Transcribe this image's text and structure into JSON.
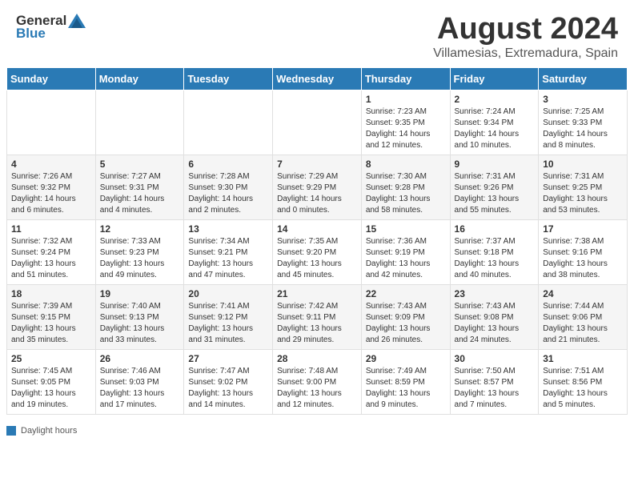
{
  "header": {
    "logo_general": "General",
    "logo_blue": "Blue",
    "title": "August 2024",
    "subtitle": "Villamesias, Extremadura, Spain"
  },
  "calendar": {
    "days_of_week": [
      "Sunday",
      "Monday",
      "Tuesday",
      "Wednesday",
      "Thursday",
      "Friday",
      "Saturday"
    ],
    "weeks": [
      [
        {
          "num": "",
          "info": ""
        },
        {
          "num": "",
          "info": ""
        },
        {
          "num": "",
          "info": ""
        },
        {
          "num": "",
          "info": ""
        },
        {
          "num": "1",
          "info": "Sunrise: 7:23 AM\nSunset: 9:35 PM\nDaylight: 14 hours and 12 minutes."
        },
        {
          "num": "2",
          "info": "Sunrise: 7:24 AM\nSunset: 9:34 PM\nDaylight: 14 hours and 10 minutes."
        },
        {
          "num": "3",
          "info": "Sunrise: 7:25 AM\nSunset: 9:33 PM\nDaylight: 14 hours and 8 minutes."
        }
      ],
      [
        {
          "num": "4",
          "info": "Sunrise: 7:26 AM\nSunset: 9:32 PM\nDaylight: 14 hours and 6 minutes."
        },
        {
          "num": "5",
          "info": "Sunrise: 7:27 AM\nSunset: 9:31 PM\nDaylight: 14 hours and 4 minutes."
        },
        {
          "num": "6",
          "info": "Sunrise: 7:28 AM\nSunset: 9:30 PM\nDaylight: 14 hours and 2 minutes."
        },
        {
          "num": "7",
          "info": "Sunrise: 7:29 AM\nSunset: 9:29 PM\nDaylight: 14 hours and 0 minutes."
        },
        {
          "num": "8",
          "info": "Sunrise: 7:30 AM\nSunset: 9:28 PM\nDaylight: 13 hours and 58 minutes."
        },
        {
          "num": "9",
          "info": "Sunrise: 7:31 AM\nSunset: 9:26 PM\nDaylight: 13 hours and 55 minutes."
        },
        {
          "num": "10",
          "info": "Sunrise: 7:31 AM\nSunset: 9:25 PM\nDaylight: 13 hours and 53 minutes."
        }
      ],
      [
        {
          "num": "11",
          "info": "Sunrise: 7:32 AM\nSunset: 9:24 PM\nDaylight: 13 hours and 51 minutes."
        },
        {
          "num": "12",
          "info": "Sunrise: 7:33 AM\nSunset: 9:23 PM\nDaylight: 13 hours and 49 minutes."
        },
        {
          "num": "13",
          "info": "Sunrise: 7:34 AM\nSunset: 9:21 PM\nDaylight: 13 hours and 47 minutes."
        },
        {
          "num": "14",
          "info": "Sunrise: 7:35 AM\nSunset: 9:20 PM\nDaylight: 13 hours and 45 minutes."
        },
        {
          "num": "15",
          "info": "Sunrise: 7:36 AM\nSunset: 9:19 PM\nDaylight: 13 hours and 42 minutes."
        },
        {
          "num": "16",
          "info": "Sunrise: 7:37 AM\nSunset: 9:18 PM\nDaylight: 13 hours and 40 minutes."
        },
        {
          "num": "17",
          "info": "Sunrise: 7:38 AM\nSunset: 9:16 PM\nDaylight: 13 hours and 38 minutes."
        }
      ],
      [
        {
          "num": "18",
          "info": "Sunrise: 7:39 AM\nSunset: 9:15 PM\nDaylight: 13 hours and 35 minutes."
        },
        {
          "num": "19",
          "info": "Sunrise: 7:40 AM\nSunset: 9:13 PM\nDaylight: 13 hours and 33 minutes."
        },
        {
          "num": "20",
          "info": "Sunrise: 7:41 AM\nSunset: 9:12 PM\nDaylight: 13 hours and 31 minutes."
        },
        {
          "num": "21",
          "info": "Sunrise: 7:42 AM\nSunset: 9:11 PM\nDaylight: 13 hours and 29 minutes."
        },
        {
          "num": "22",
          "info": "Sunrise: 7:43 AM\nSunset: 9:09 PM\nDaylight: 13 hours and 26 minutes."
        },
        {
          "num": "23",
          "info": "Sunrise: 7:43 AM\nSunset: 9:08 PM\nDaylight: 13 hours and 24 minutes."
        },
        {
          "num": "24",
          "info": "Sunrise: 7:44 AM\nSunset: 9:06 PM\nDaylight: 13 hours and 21 minutes."
        }
      ],
      [
        {
          "num": "25",
          "info": "Sunrise: 7:45 AM\nSunset: 9:05 PM\nDaylight: 13 hours and 19 minutes."
        },
        {
          "num": "26",
          "info": "Sunrise: 7:46 AM\nSunset: 9:03 PM\nDaylight: 13 hours and 17 minutes."
        },
        {
          "num": "27",
          "info": "Sunrise: 7:47 AM\nSunset: 9:02 PM\nDaylight: 13 hours and 14 minutes."
        },
        {
          "num": "28",
          "info": "Sunrise: 7:48 AM\nSunset: 9:00 PM\nDaylight: 13 hours and 12 minutes."
        },
        {
          "num": "29",
          "info": "Sunrise: 7:49 AM\nSunset: 8:59 PM\nDaylight: 13 hours and 9 minutes."
        },
        {
          "num": "30",
          "info": "Sunrise: 7:50 AM\nSunset: 8:57 PM\nDaylight: 13 hours and 7 minutes."
        },
        {
          "num": "31",
          "info": "Sunrise: 7:51 AM\nSunset: 8:56 PM\nDaylight: 13 hours and 5 minutes."
        }
      ]
    ]
  },
  "footer": {
    "label": "Daylight hours"
  }
}
